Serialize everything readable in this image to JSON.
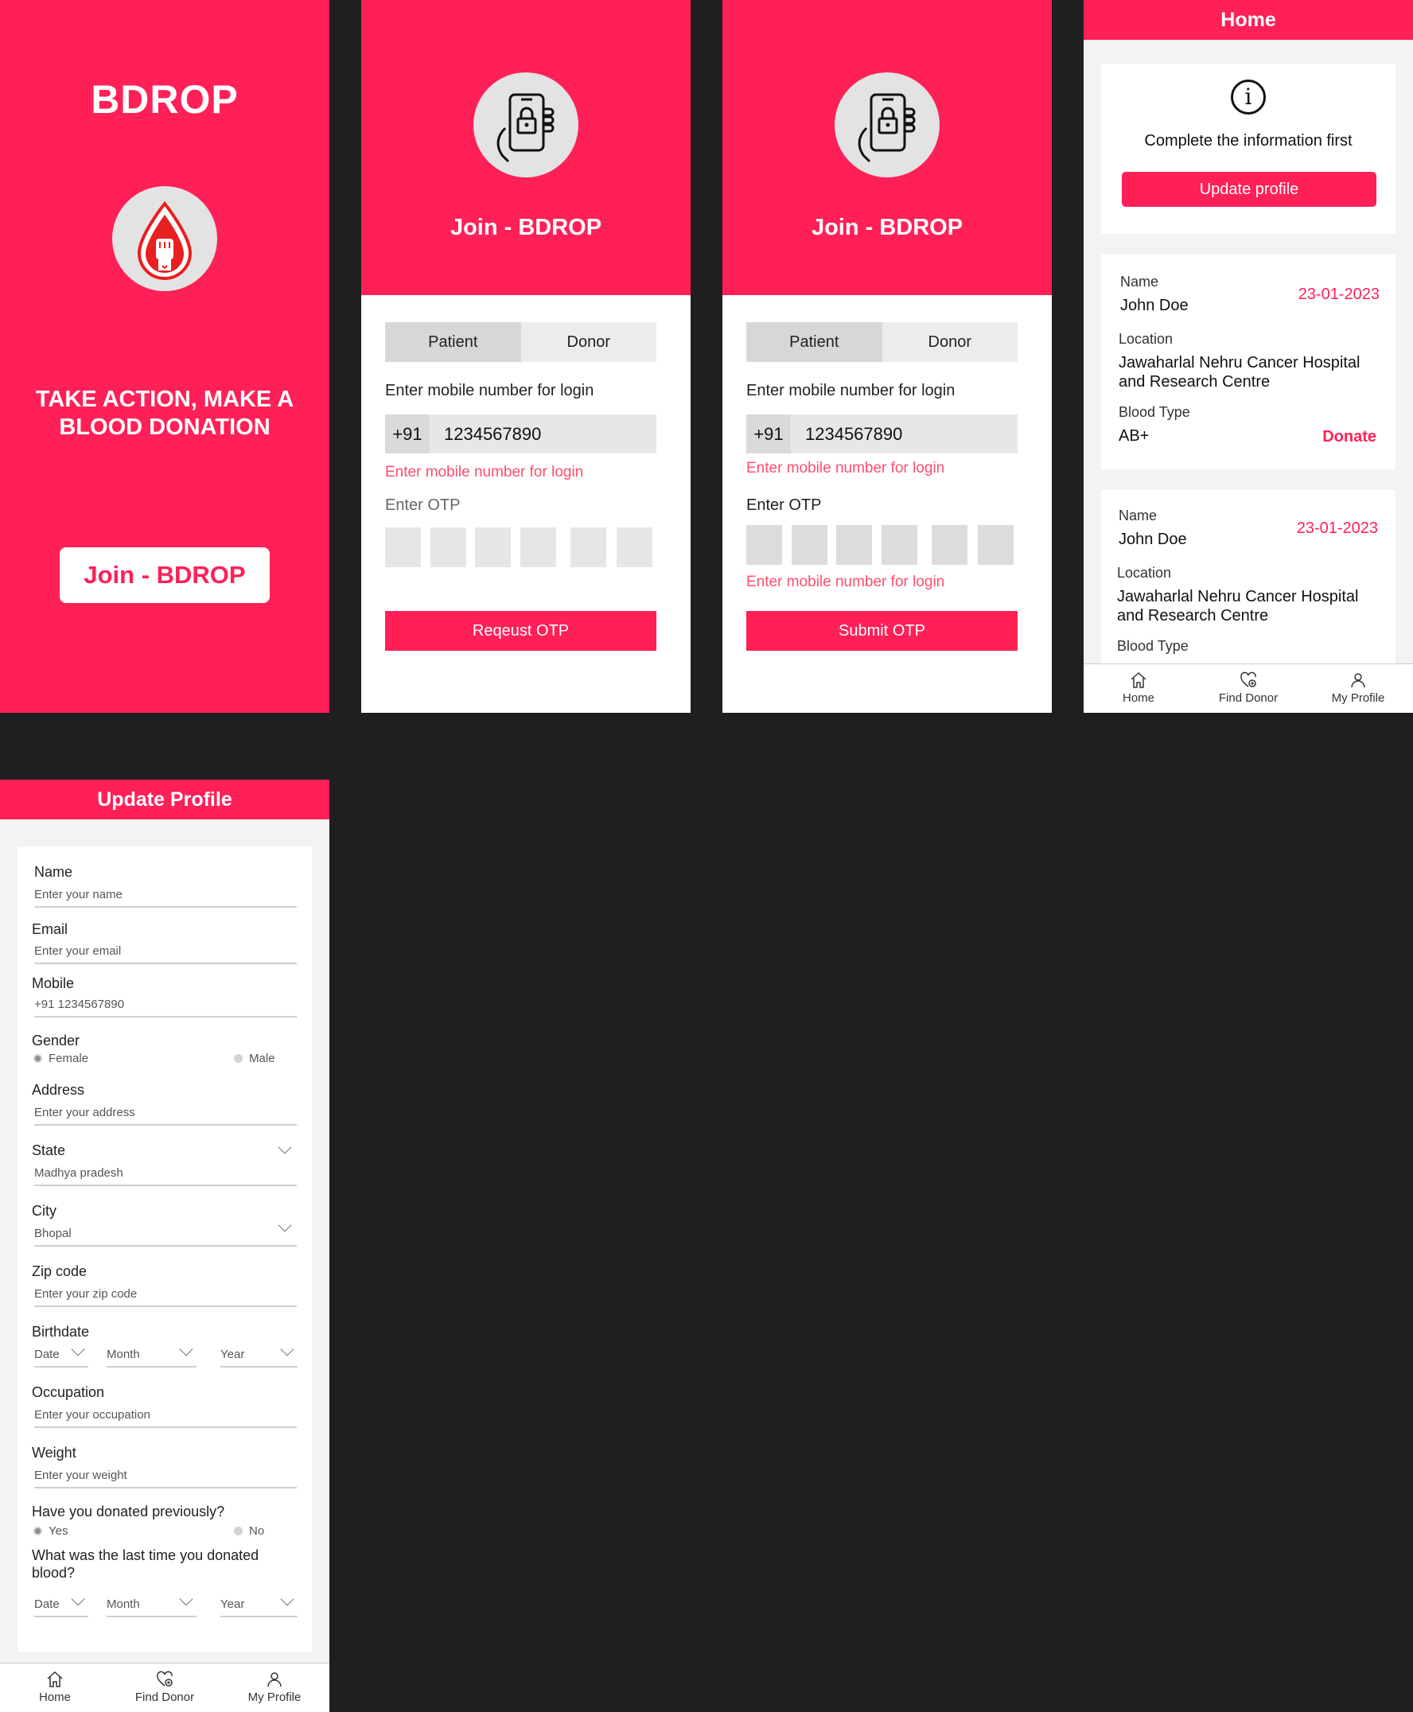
{
  "splash": {
    "brand": "BDROP",
    "tagline": "TAKE ACTION, MAKE A BLOOD DONATION",
    "join_button": "Join - BDROP"
  },
  "login": {
    "title": "Join - BDROP",
    "tab_patient": "Patient",
    "tab_donor": "Donor",
    "mobile_label": "Enter mobile number for login",
    "country_code": "+91",
    "mobile_value": "1234567890",
    "error_text": "Enter mobile number for login",
    "otp_label": "Enter OTP",
    "request_button": "Reqeust OTP",
    "submit_button": "Submit OTP"
  },
  "home": {
    "title": "Home",
    "notice_text": "Complete the information first",
    "update_button": "Update profile",
    "name_label": "Name",
    "location_label": "Location",
    "blood_type_label": "Blood Type",
    "donate_label": "Donate",
    "requests": [
      {
        "name": "John Doe",
        "date": "23-01-2023",
        "location_line1": "Jawaharlal Nehru Cancer Hospital",
        "location_line2": "and Research Centre",
        "blood_type": "AB+"
      },
      {
        "name": "John Doe",
        "date": "23-01-2023",
        "location_line1": "Jawaharlal Nehru Cancer Hospital",
        "location_line2": "and Research Centre"
      }
    ]
  },
  "nav": {
    "home": "Home",
    "find_donor": "Find Donor",
    "my_profile": "My Profile"
  },
  "profile": {
    "title": "Update Profile",
    "name_label": "Name",
    "name_placeholder": "Enter your name",
    "email_label": "Email",
    "email_placeholder": "Enter your email",
    "mobile_label": "Mobile",
    "mobile_value": "+91 1234567890",
    "gender_label": "Gender",
    "gender_female": "Female",
    "gender_male": "Male",
    "address_label": "Address",
    "address_placeholder": "Enter your address",
    "state_label": "State",
    "state_value": "Madhya pradesh",
    "city_label": "City",
    "city_value": "Bhopal",
    "zip_label": "Zip code",
    "zip_placeholder": "Enter your zip code",
    "birthdate_label": "Birthdate",
    "date_option": "Date",
    "month_option": "Month",
    "year_option": "Year",
    "occupation_label": "Occupation",
    "occupation_placeholder": "Enter your occupation",
    "weight_label": "Weight",
    "weight_placeholder": "Enter your weight",
    "donated_question": "Have you donated previously?",
    "yes_option": "Yes",
    "no_option": "No",
    "last_donated_question_line1": "What was the last time you donated",
    "last_donated_question_line2": "blood?"
  },
  "colors": {
    "brand": "#ff2057",
    "background": "#1f1f1f",
    "error": "#ff4d6d"
  },
  "icons": [
    "blood-drop-icon",
    "phone-lock-icon",
    "info-icon",
    "home-icon",
    "find-donor-icon",
    "profile-icon",
    "chevron-down-icon"
  ]
}
